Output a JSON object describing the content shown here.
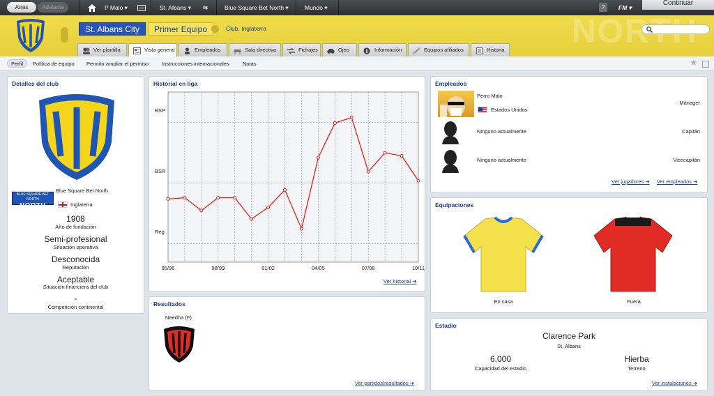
{
  "topbar": {
    "back_label": "Atrás",
    "forward_label": "Adelante",
    "manager_name": "P Malo",
    "club_name": "St. Albans",
    "league_name": "Blue Square Bet North",
    "world_label": "Mundo",
    "help_label": "?",
    "fm_label": "FM",
    "continue_label": "Continuar"
  },
  "header": {
    "club_name": "St. Albans City",
    "team_select": "Primer Equipo",
    "club_country": "Club, Inglaterra",
    "watermark": "NORTH",
    "search_placeholder": ""
  },
  "tabs": [
    {
      "label": "Ver plantilla",
      "icon": "squad-icon"
    },
    {
      "label": "Vista general",
      "icon": "overview-icon"
    },
    {
      "label": "Empleados",
      "icon": "staff-icon"
    },
    {
      "label": "Sala directiva",
      "icon": "boardroom-icon"
    },
    {
      "label": "Fichajes",
      "icon": "transfers-icon"
    },
    {
      "label": "Ojeo",
      "icon": "scouting-icon"
    },
    {
      "label": "Información",
      "icon": "info-icon"
    },
    {
      "label": "Equipos afiliados",
      "icon": "affiliates-icon"
    },
    {
      "label": "Historia",
      "icon": "history-icon"
    }
  ],
  "subnav": [
    "Perfil",
    "Política de equipo",
    "Permitir ampliar el permiso",
    "Instrucciones internacionales",
    "Notas"
  ],
  "club_details": {
    "title": "Detalles del club",
    "league_logo_text": "BLUE SQUARE BET NORTH",
    "league": "Blue Square Bet North",
    "country": "Inglaterra",
    "founded": "1908",
    "founded_label": "Año de fundación",
    "status": "Semi-profesional",
    "status_label": "Situación operativa",
    "reputation": "Desconocida",
    "reputation_label": "Reputación",
    "finance": "Aceptable",
    "finance_label": "Situación financiera del club",
    "continental": "-",
    "continental_label": "Competición continental",
    "colors": {
      "yellow": "#f3d51c",
      "blue": "#1f56b5"
    }
  },
  "league_history": {
    "title": "Historial en liga",
    "link": "Ver historial",
    "chart_data": {
      "type": "line",
      "title": "Historial en liga",
      "x": [
        "95/96",
        "96/97",
        "97/98",
        "98/99",
        "99/00",
        "00/01",
        "01/02",
        "02/03",
        "03/04",
        "04/05",
        "05/06",
        "06/07",
        "07/08",
        "08/09",
        "09/10",
        "10/11"
      ],
      "x_tick_labels": [
        "95/96",
        "98/99",
        "01/02",
        "04/05",
        "07/08",
        "10/11"
      ],
      "y_tick_labels": [
        "BSP",
        "BSR",
        "Reg"
      ],
      "series": [
        {
          "values": [
            -0.26,
            -0.24,
            -0.45,
            -0.24,
            -0.24,
            -0.59,
            -0.4,
            -0.11,
            -0.75,
            0.42,
            0.99,
            1.08,
            0.19,
            0.5,
            0.45,
            0.04
          ]
        }
      ],
      "y_scale_note": "0 = BSR, 1 = BSP, -1 = Reg",
      "ylim": [
        -1.3,
        1.5
      ],
      "grid": true,
      "color": "#e42222"
    }
  },
  "results": {
    "title": "Resultados",
    "opponent": "Needha (F)",
    "link": "Ver partidos/resultados"
  },
  "staff": {
    "title": "Empleados",
    "rows": [
      {
        "name": "Perro Malo",
        "nation": "Estados Unidos",
        "role": "Mánager"
      },
      {
        "name": "Ninguno actualmente",
        "role": "Capitán"
      },
      {
        "name": "Ninguno actualmente",
        "role": "Vicecapitán"
      }
    ],
    "link_players": "Ver jugadores",
    "link_staff": "Ver empleados"
  },
  "kits": {
    "title": "Equipaciones",
    "home_label": "En casa",
    "away_label": "Fuera",
    "home_color": "#f4e04a",
    "home_trim": "#2a6ad8",
    "away_color": "#e12b25",
    "away_trim": "#1a1a1a"
  },
  "stadium": {
    "title": "Estadio",
    "name": "Clarence Park",
    "city": "St. Albans",
    "capacity": "6,000",
    "capacity_label": "Capacidad del estadio",
    "surface": "Hierba",
    "surface_label": "Terreno",
    "link": "Ver instalaciones"
  }
}
